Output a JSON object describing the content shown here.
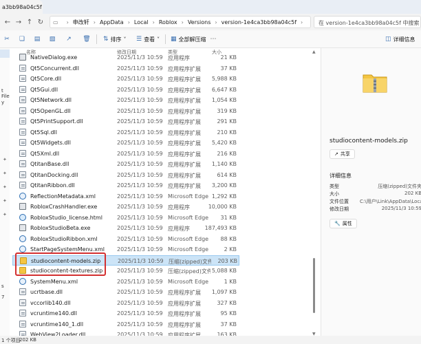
{
  "window": {
    "tab_title": "a3bb98a04c5f"
  },
  "addressbar": {
    "crumbs": [
      "申改轩",
      "AppData",
      "Local",
      "Roblox",
      "Versions",
      "version-1e4ca3bb98a04c5f"
    ],
    "search_placeholder": "在 version-1e4ca3bb98a04c5f 中搜索"
  },
  "toolbar": {
    "sort_label": "排序",
    "view_label": "查看",
    "extract_label": "全部解压缩",
    "details_label": "详细信息"
  },
  "columns": {
    "name": "名称",
    "date": "修改日期",
    "type": "类型",
    "size": "大小"
  },
  "files": [
    {
      "name": "NativeDialog.exe",
      "date": "2025/11/3 10:59",
      "type": "应用程序",
      "size": "21 KB",
      "icon": "exe"
    },
    {
      "name": "Qt5Concurrent.dll",
      "date": "2025/11/3 10:59",
      "type": "应用程序扩展",
      "size": "37 KB",
      "icon": "dll"
    },
    {
      "name": "Qt5Core.dll",
      "date": "2025/11/3 10:59",
      "type": "应用程序扩展",
      "size": "5,988 KB",
      "icon": "dll"
    },
    {
      "name": "Qt5Gui.dll",
      "date": "2025/11/3 10:59",
      "type": "应用程序扩展",
      "size": "6,647 KB",
      "icon": "dll"
    },
    {
      "name": "Qt5Network.dll",
      "date": "2025/11/3 10:59",
      "type": "应用程序扩展",
      "size": "1,054 KB",
      "icon": "dll"
    },
    {
      "name": "Qt5OpenGL.dll",
      "date": "2025/11/3 10:59",
      "type": "应用程序扩展",
      "size": "319 KB",
      "icon": "dll"
    },
    {
      "name": "Qt5PrintSupport.dll",
      "date": "2025/11/3 10:59",
      "type": "应用程序扩展",
      "size": "291 KB",
      "icon": "dll"
    },
    {
      "name": "Qt5Sql.dll",
      "date": "2025/11/3 10:59",
      "type": "应用程序扩展",
      "size": "210 KB",
      "icon": "dll"
    },
    {
      "name": "Qt5Widgets.dll",
      "date": "2025/11/3 10:59",
      "type": "应用程序扩展",
      "size": "5,420 KB",
      "icon": "dll"
    },
    {
      "name": "Qt5Xml.dll",
      "date": "2025/11/3 10:59",
      "type": "应用程序扩展",
      "size": "216 KB",
      "icon": "dll"
    },
    {
      "name": "QtitanBase.dll",
      "date": "2025/11/3 10:59",
      "type": "应用程序扩展",
      "size": "1,140 KB",
      "icon": "dll"
    },
    {
      "name": "QtitanDocking.dll",
      "date": "2025/11/3 10:59",
      "type": "应用程序扩展",
      "size": "614 KB",
      "icon": "dll"
    },
    {
      "name": "QtitanRibbon.dll",
      "date": "2025/11/3 10:59",
      "type": "应用程序扩展",
      "size": "3,200 KB",
      "icon": "dll"
    },
    {
      "name": "ReflectionMetadata.xml",
      "date": "2025/11/3 10:59",
      "type": "Microsoft Edge ...",
      "size": "1,292 KB",
      "icon": "xml"
    },
    {
      "name": "RobloxCrashHandler.exe",
      "date": "2025/11/3 10:59",
      "type": "应用程序",
      "size": "10,000 KB",
      "icon": "exe"
    },
    {
      "name": "RobloxStudio_license.html",
      "date": "2025/11/3 10:59",
      "type": "Microsoft Edge ...",
      "size": "31 KB",
      "icon": "htm"
    },
    {
      "name": "RobloxStudioBeta.exe",
      "date": "2025/11/3 10:59",
      "type": "应用程序",
      "size": "187,493 KB",
      "icon": "exe"
    },
    {
      "name": "RobloxStudioRibbon.xml",
      "date": "2025/11/3 10:59",
      "type": "Microsoft Edge ...",
      "size": "88 KB",
      "icon": "xml"
    },
    {
      "name": "StartPageSystemMenu.xml",
      "date": "2025/11/3 10:59",
      "type": "Microsoft Edge ...",
      "size": "2 KB",
      "icon": "xml"
    },
    {
      "name": "studiocontent-models.zip",
      "date": "2025/11/3 10:59",
      "type": "压缩(zipped)文件...",
      "size": "203 KB",
      "icon": "zip",
      "selected": true
    },
    {
      "name": "studiocontent-textures.zip",
      "date": "2025/11/3 10:59",
      "type": "压缩(zipped)文件...",
      "size": "5,088 KB",
      "icon": "zip"
    },
    {
      "name": "SystemMenu.xml",
      "date": "2025/11/3 10:59",
      "type": "Microsoft Edge ...",
      "size": "1 KB",
      "icon": "xml"
    },
    {
      "name": "ucrtbase.dll",
      "date": "2025/11/3 10:59",
      "type": "应用程序扩展",
      "size": "1,097 KB",
      "icon": "dll"
    },
    {
      "name": "vccorlib140.dll",
      "date": "2025/11/3 10:59",
      "type": "应用程序扩展",
      "size": "327 KB",
      "icon": "dll"
    },
    {
      "name": "vcruntime140.dll",
      "date": "2025/11/3 10:59",
      "type": "应用程序扩展",
      "size": "95 KB",
      "icon": "dll"
    },
    {
      "name": "vcruntime140_1.dll",
      "date": "2025/11/3 10:59",
      "type": "应用程序扩展",
      "size": "37 KB",
      "icon": "dll"
    },
    {
      "name": "WebView2Loader.dll",
      "date": "2025/11/3 10:59",
      "type": "应用程序扩展",
      "size": "163 KB",
      "icon": "dll"
    }
  ],
  "leftnav": {
    "partial_labels": [
      "t File",
      "y",
      "s",
      "7"
    ]
  },
  "details": {
    "file_name": "studiocontent-models.zip",
    "share_label": "共享",
    "section_title": "详细信息",
    "props": [
      {
        "label": "类型",
        "value": "压缩(zipped)文件夹"
      },
      {
        "label": "大小",
        "value": "202 KB"
      },
      {
        "label": "文件位置",
        "value": "C:\\用户\\Link\\AppData\\Local\\..."
      },
      {
        "label": "修改日期",
        "value": "2025/11/3 10:59"
      }
    ],
    "properties_label": "属性"
  },
  "status": {
    "count": "1 个项目",
    "selection": "202 KB"
  }
}
